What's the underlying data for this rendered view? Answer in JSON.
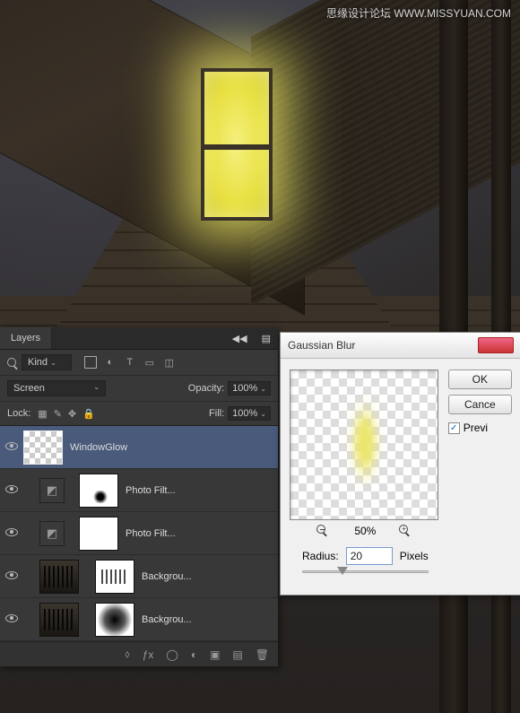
{
  "watermark": "思缘设计论坛  WWW.MISSYUAN.COM",
  "layersPanel": {
    "tab": "Layers",
    "kindLabel": "Kind",
    "blendMode": "Screen",
    "opacityLabel": "Opacity:",
    "opacityValue": "100%",
    "lockLabel": "Lock:",
    "fillLabel": "Fill:",
    "fillValue": "100%",
    "layers": [
      {
        "name": "WindowGlow"
      },
      {
        "name": "Photo Filt..."
      },
      {
        "name": "Photo Filt..."
      },
      {
        "name": "Backgrou..."
      },
      {
        "name": "Backgrou..."
      }
    ]
  },
  "dialog": {
    "title": "Gaussian Blur",
    "okLabel": "OK",
    "cancelLabel": "Cance",
    "previewLabel": "Previ",
    "zoomValue": "50%",
    "radiusLabel": "Radius:",
    "radiusValue": "20",
    "radiusUnit": "Pixels"
  }
}
